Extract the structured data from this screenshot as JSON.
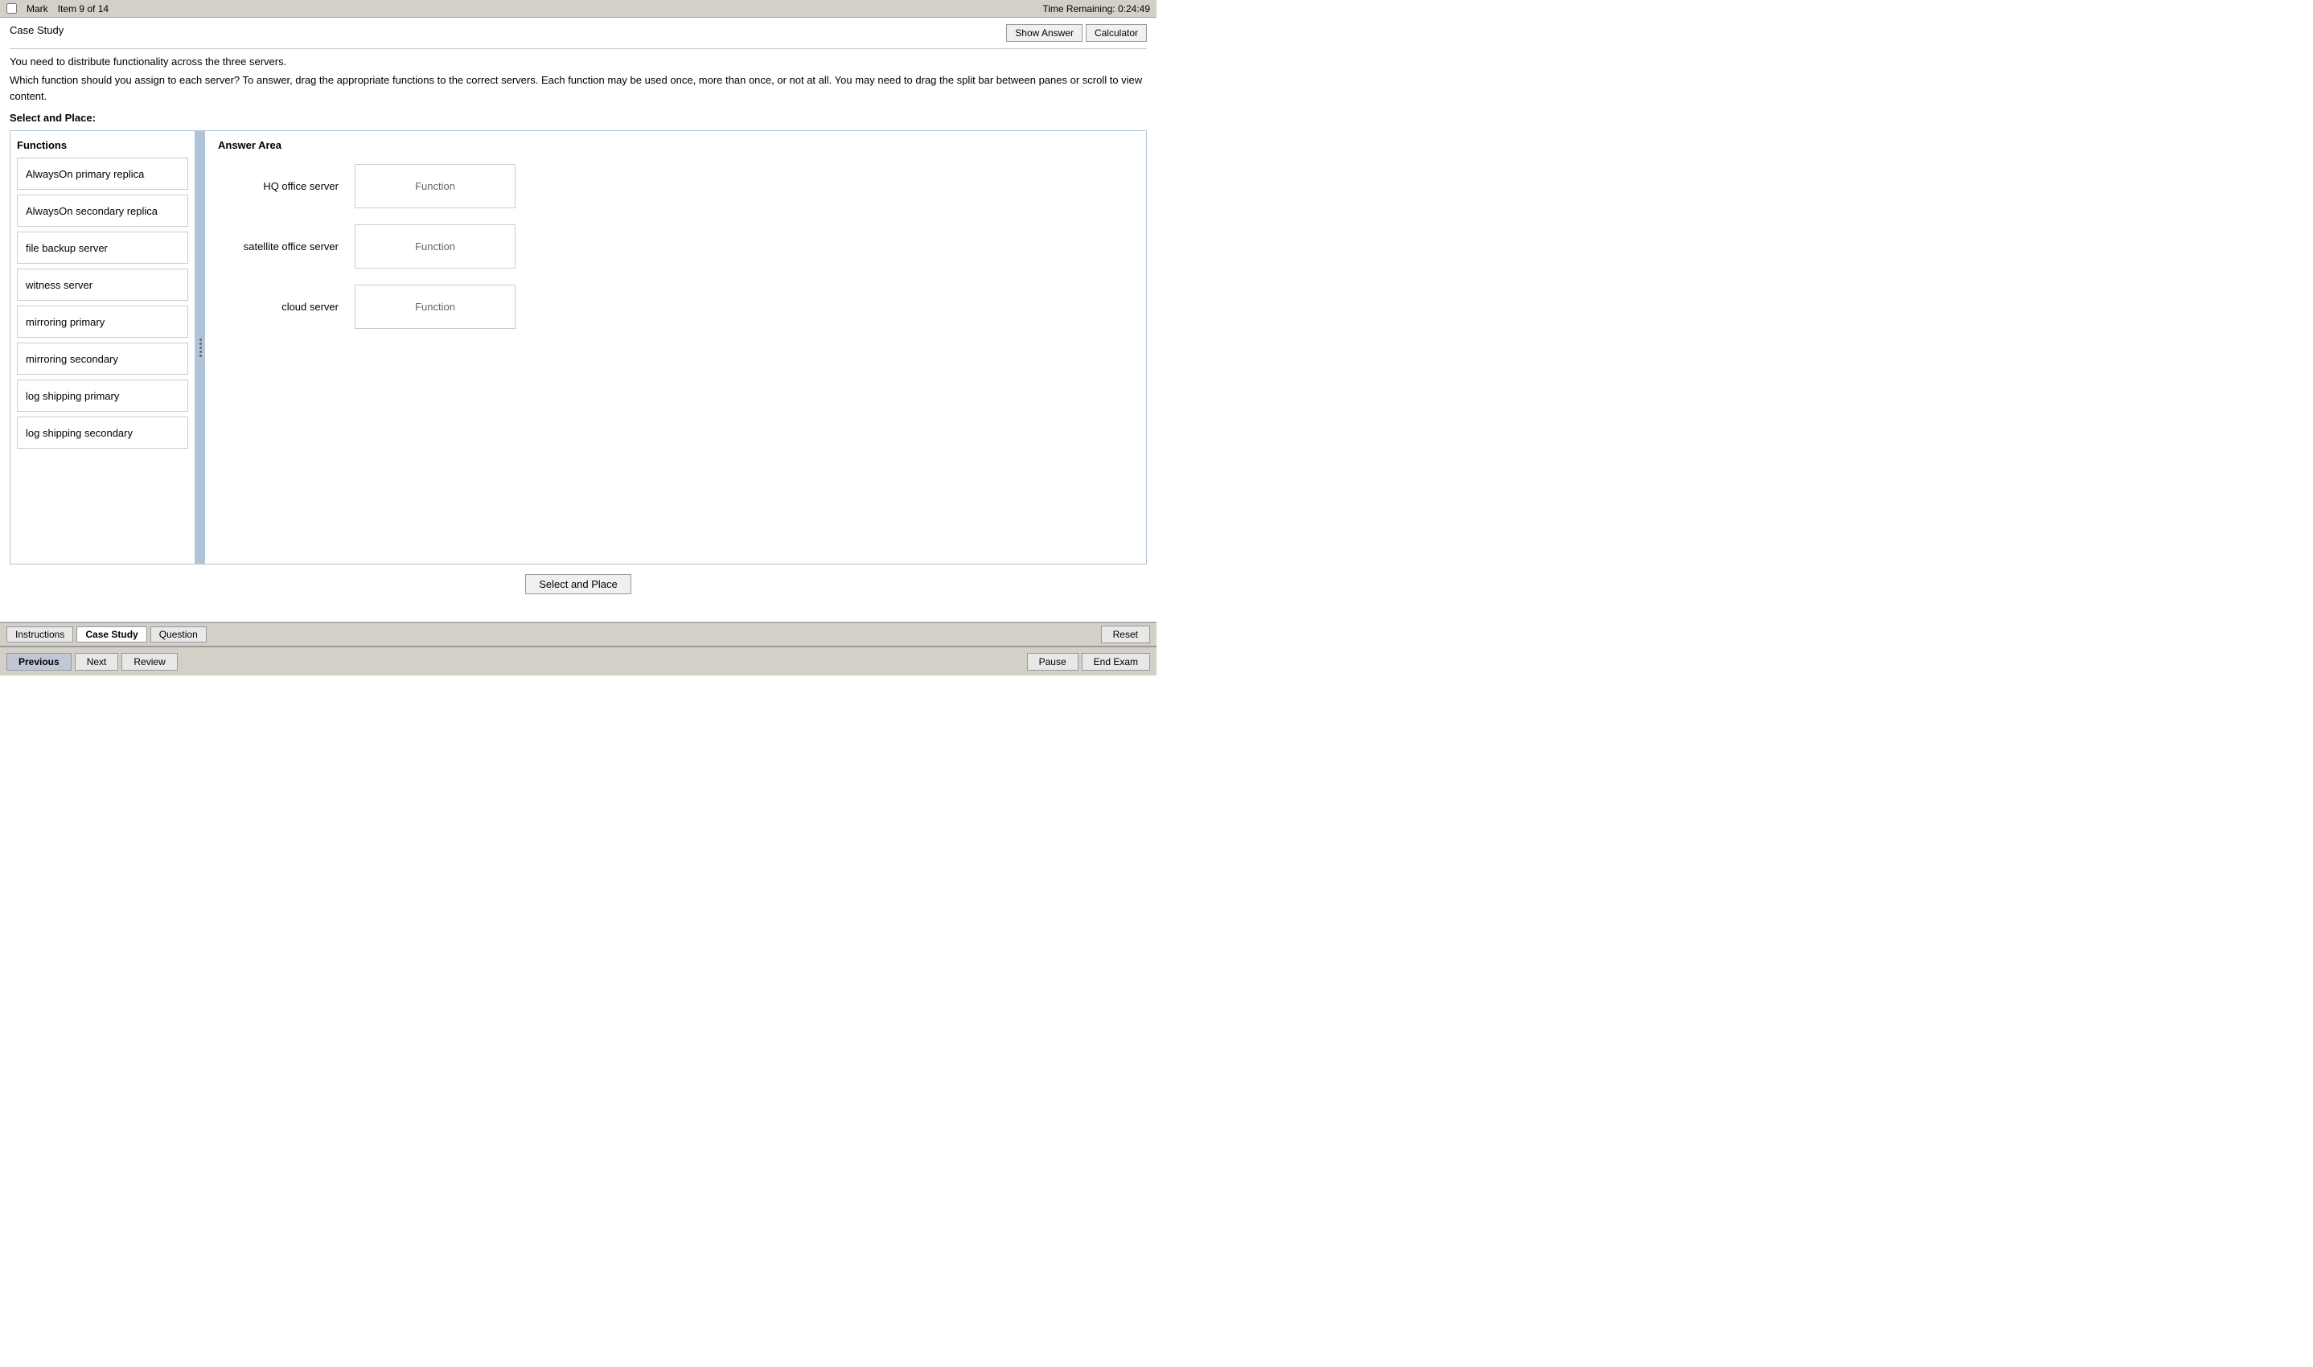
{
  "topbar": {
    "mark_label": "Mark",
    "item_info": "Item 9 of 14",
    "time_remaining": "Time Remaining: 0:24:49"
  },
  "header": {
    "case_study_label": "Case Study",
    "show_answer_btn": "Show Answer",
    "calculator_btn": "Calculator"
  },
  "instructions": {
    "text1": "You need to distribute functionality across the three servers.",
    "text2": "Which function should you assign to each server? To answer, drag the appropriate functions to the correct servers. Each function may be used once, more than once, or not at all. You may need to drag the split bar between panes or scroll to view content.",
    "select_place": "Select and Place:"
  },
  "functions_panel": {
    "title": "Functions",
    "items": [
      {
        "id": "func1",
        "label": "AlwaysOn primary replica"
      },
      {
        "id": "func2",
        "label": "AlwaysOn secondary replica"
      },
      {
        "id": "func3",
        "label": "file backup server"
      },
      {
        "id": "func4",
        "label": "witness server"
      },
      {
        "id": "func5",
        "label": "mirroring primary"
      },
      {
        "id": "func6",
        "label": "mirroring secondary"
      },
      {
        "id": "func7",
        "label": "log shipping primary"
      },
      {
        "id": "func8",
        "label": "log shipping secondary"
      }
    ]
  },
  "answer_panel": {
    "title": "Answer Area",
    "rows": [
      {
        "id": "hq",
        "server": "HQ office server",
        "placeholder": "Function"
      },
      {
        "id": "satellite",
        "server": "satellite office server",
        "placeholder": "Function"
      },
      {
        "id": "cloud",
        "server": "cloud server",
        "placeholder": "Function"
      }
    ]
  },
  "select_place_button": "Select and Place",
  "bottom_tabs": {
    "tabs": [
      {
        "id": "instructions",
        "label": "Instructions",
        "active": false
      },
      {
        "id": "case-study",
        "label": "Case Study",
        "active": true
      },
      {
        "id": "question",
        "label": "Question",
        "active": false
      }
    ],
    "reset_btn": "Reset"
  },
  "bottom_nav": {
    "previous_btn": "Previous",
    "next_btn": "Next",
    "review_btn": "Review",
    "pause_btn": "Pause",
    "end_exam_btn": "End Exam"
  }
}
